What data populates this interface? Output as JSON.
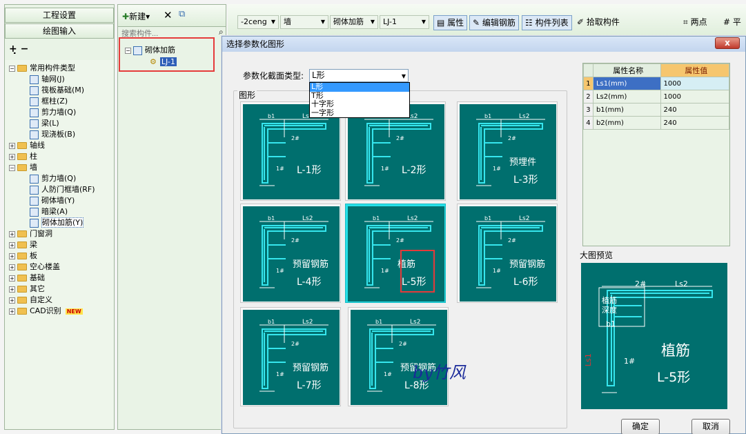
{
  "left_panel": {
    "btn_project_settings": "工程设置",
    "btn_drawing_input": "绘图输入",
    "tree": [
      {
        "label": "常用构件类型",
        "level": 0,
        "expanded": true,
        "type": "folder"
      },
      {
        "label": "轴网(J)",
        "level": 1,
        "type": "item"
      },
      {
        "label": "筏板基础(M)",
        "level": 1,
        "type": "item"
      },
      {
        "label": "框柱(Z)",
        "level": 1,
        "type": "item"
      },
      {
        "label": "剪力墙(Q)",
        "level": 1,
        "type": "item"
      },
      {
        "label": "梁(L)",
        "level": 1,
        "type": "item"
      },
      {
        "label": "现浇板(B)",
        "level": 1,
        "type": "item"
      },
      {
        "label": "轴线",
        "level": 0,
        "expanded": false,
        "type": "folder"
      },
      {
        "label": "柱",
        "level": 0,
        "expanded": false,
        "type": "folder"
      },
      {
        "label": "墙",
        "level": 0,
        "expanded": true,
        "type": "folder"
      },
      {
        "label": "剪力墙(Q)",
        "level": 1,
        "type": "item"
      },
      {
        "label": "人防门框墙(RF)",
        "level": 1,
        "type": "item"
      },
      {
        "label": "砌体墙(Y)",
        "level": 1,
        "type": "item"
      },
      {
        "label": "暗梁(A)",
        "level": 1,
        "type": "item"
      },
      {
        "label": "砌体加筋(Y)",
        "level": 1,
        "type": "item",
        "selected": true
      },
      {
        "label": "门窗洞",
        "level": 0,
        "expanded": false,
        "type": "folder"
      },
      {
        "label": "梁",
        "level": 0,
        "expanded": false,
        "type": "folder"
      },
      {
        "label": "板",
        "level": 0,
        "expanded": false,
        "type": "folder"
      },
      {
        "label": "空心楼盖",
        "level": 0,
        "expanded": false,
        "type": "folder"
      },
      {
        "label": "基础",
        "level": 0,
        "expanded": false,
        "type": "folder"
      },
      {
        "label": "其它",
        "level": 0,
        "expanded": false,
        "type": "folder"
      },
      {
        "label": "自定义",
        "level": 0,
        "expanded": false,
        "type": "folder"
      },
      {
        "label": "CAD识别",
        "level": 0,
        "expanded": false,
        "type": "folder",
        "badge": "NEW"
      }
    ]
  },
  "mid_panel": {
    "new_label": "新建",
    "search_placeholder": "搜索构件...",
    "tree_root": "砌体加筋",
    "tree_child": "LJ-1"
  },
  "toolbar": {
    "floor": "-2ceng",
    "category": "墙",
    "type": "砌体加筋",
    "component": "LJ-1",
    "btn_properties": "属性",
    "btn_edit_rebar": "编辑钢筋",
    "btn_component_list": "构件列表",
    "btn_pick": "拾取构件",
    "btn_two_points": "两点",
    "btn_parallel": "平"
  },
  "dialog": {
    "title": "选择参数化图形",
    "close": "x",
    "section_type_label": "参数化截面类型:",
    "section_type_value": "L形",
    "section_type_options": [
      "L形",
      "T形",
      "十字形",
      "一字形"
    ],
    "shapes_label": "图形",
    "shapes": [
      {
        "name": "L-1形",
        "sub": ""
      },
      {
        "name": "L-2形",
        "sub": ""
      },
      {
        "name": "L-3形",
        "sub": "预埋件"
      },
      {
        "name": "L-4形",
        "sub": "预留钢筋"
      },
      {
        "name": "L-5形",
        "sub": "植筋",
        "selected": true
      },
      {
        "name": "L-6形",
        "sub": "预留钢筋"
      },
      {
        "name": "L-7形",
        "sub": "预留钢筋"
      },
      {
        "name": "L-8形",
        "sub": "预留钢筋"
      }
    ],
    "property_table": {
      "headers": [
        "属性名称",
        "属性值"
      ],
      "rows": [
        {
          "no": "1",
          "name": "Ls1(mm)",
          "value": "1000"
        },
        {
          "no": "2",
          "name": "Ls2(mm)",
          "value": "1000"
        },
        {
          "no": "3",
          "name": "b1(mm)",
          "value": "240"
        },
        {
          "no": "4",
          "name": "b2(mm)",
          "value": "240"
        }
      ]
    },
    "preview_label": "大图预览",
    "preview": {
      "title": "植筋",
      "name": "L-5形",
      "depth_label": "植筋\n深度"
    },
    "ok": "确定",
    "cancel": "取消"
  },
  "watermark": "by竹风",
  "colors": {
    "tile_bg": "#006f6e",
    "rebar": "#36e6ee",
    "accent_red": "#e53a3a",
    "prop_header": "#f6c66e"
  }
}
